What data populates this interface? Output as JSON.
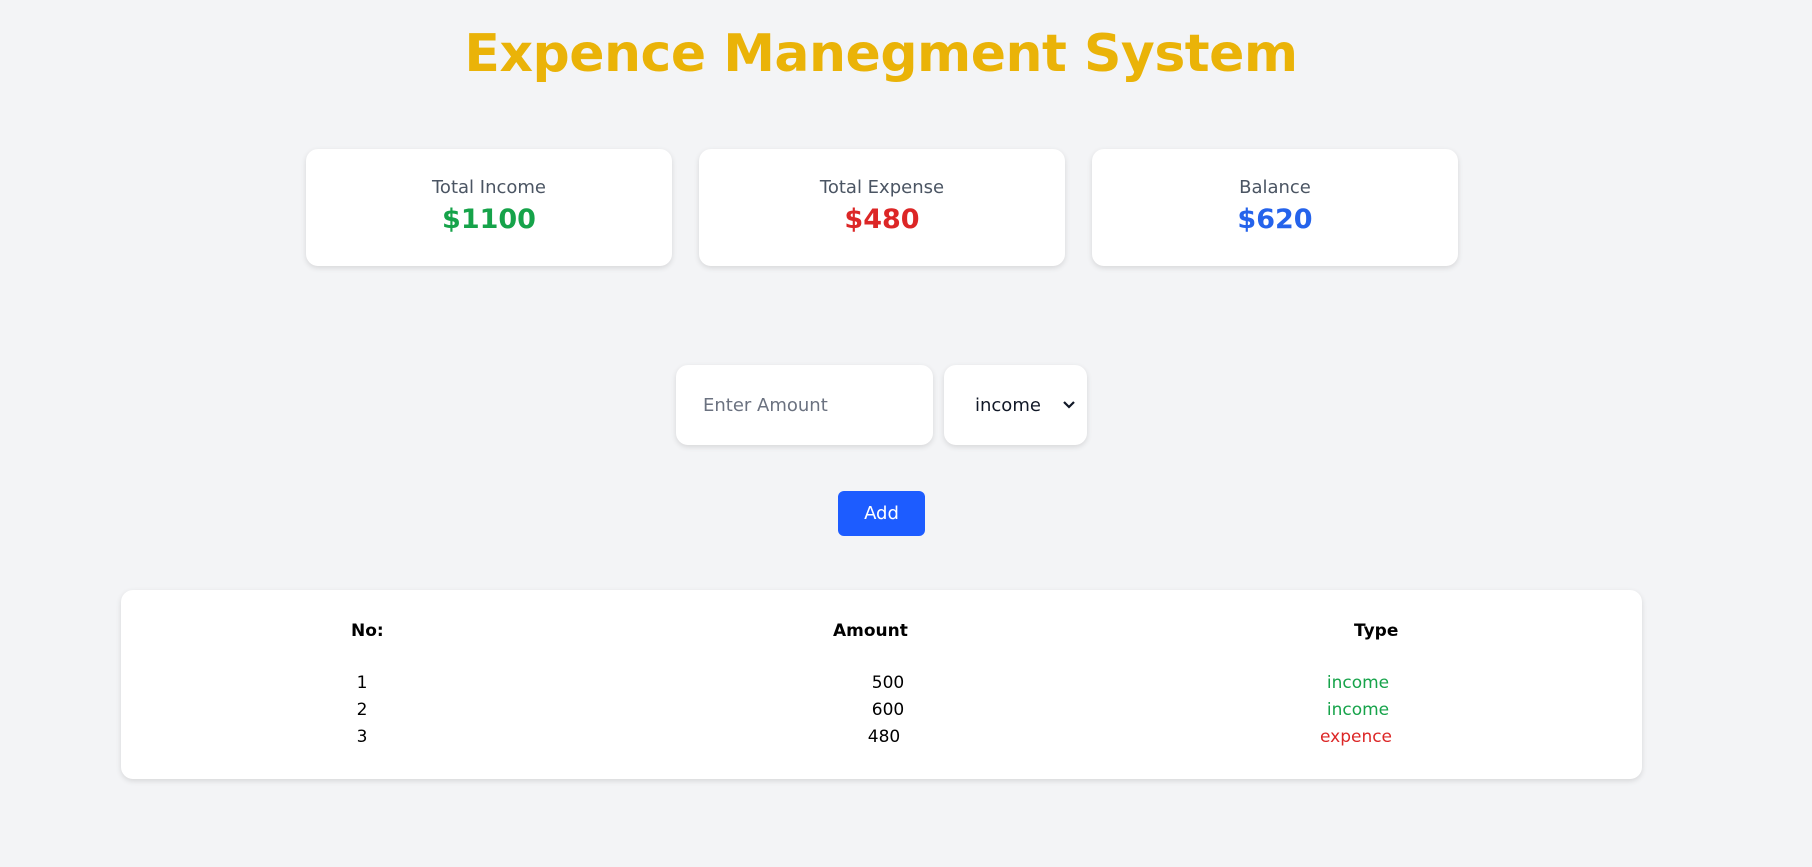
{
  "app": {
    "title": "Expence Manegment System"
  },
  "summary": {
    "income": {
      "label": "Total Income",
      "value": "$1100"
    },
    "expense": {
      "label": "Total Expense",
      "value": "$480"
    },
    "balance": {
      "label": "Balance",
      "value": "$620"
    }
  },
  "form": {
    "amount_value": "",
    "amount_placeholder": "Enter Amount",
    "type_selected": "income",
    "add_label": "Add"
  },
  "table": {
    "headers": {
      "no": "No:",
      "amount": "Amount",
      "type": "Type"
    },
    "rows": [
      {
        "no": "1",
        "amount": "500",
        "type": "income"
      },
      {
        "no": "2",
        "amount": "600",
        "type": "income"
      },
      {
        "no": "3",
        "amount": "480",
        "type": "expence"
      }
    ]
  },
  "colors": {
    "title": "#eab308",
    "income": "#16a34a",
    "expense": "#dc2626",
    "balance": "#2563eb",
    "button": "#1d5cff",
    "background": "#f3f4f6"
  },
  "icons": {
    "select_chevron": "chevron-down-icon"
  }
}
